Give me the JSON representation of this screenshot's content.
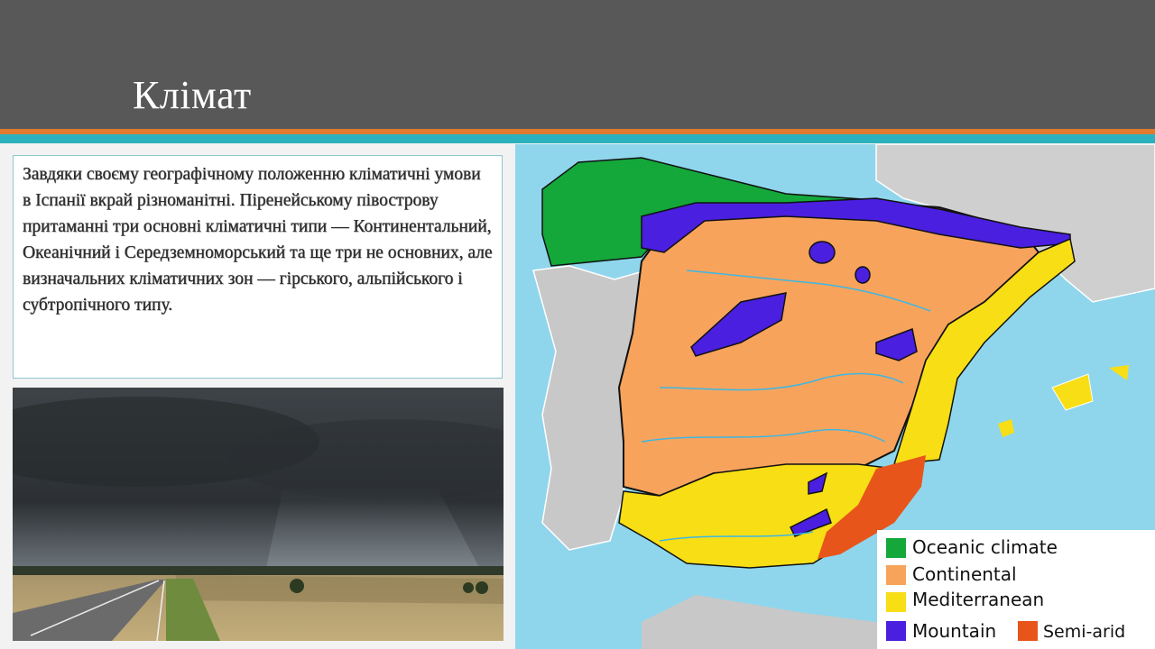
{
  "slide": {
    "title": "Клімат",
    "body_text": "Завдяки своєму географічному положенню кліматичні умови в Іспанії вкрай різноманітні. Піренейському півострову притаманні три основні кліматичні типи — Континентальний, Океанічний і Середземноморський та ще три не основних, але визначальних кліматичних зон — гірського, альпійського і субтропічного типу."
  },
  "map": {
    "legend": [
      {
        "label": "Oceanic climate",
        "color": "#14a83a"
      },
      {
        "label": "Continental",
        "color": "#f7a35c"
      },
      {
        "label": "Mediterranean",
        "color": "#f8de15"
      },
      {
        "label": "Mountain",
        "color": "#4a1fe0"
      },
      {
        "label": "Semi-arid",
        "color": "#e8551a"
      }
    ]
  },
  "colors": {
    "header_bg": "#585858",
    "accent_orange": "#e07a2e",
    "accent_teal": "#2bb1bd",
    "sea": "#8fd6ec",
    "land_other": "#c8c8c8"
  }
}
